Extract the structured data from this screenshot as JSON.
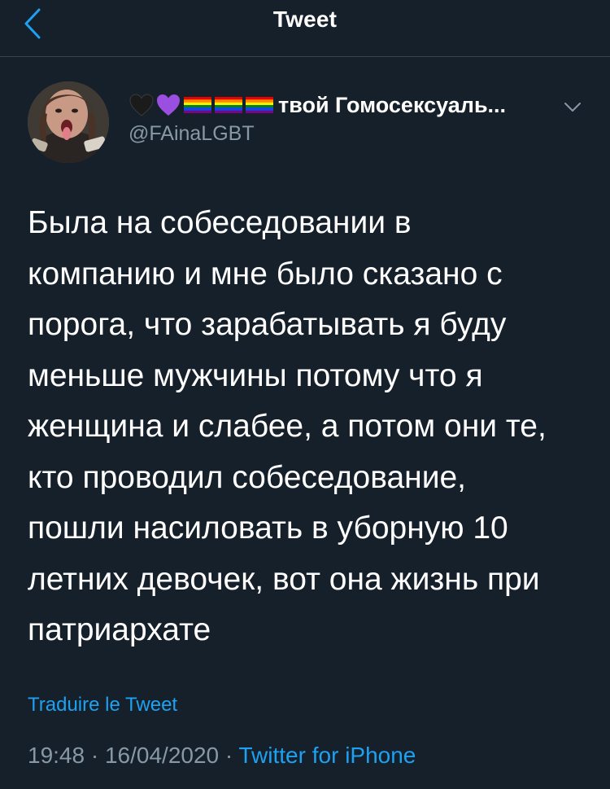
{
  "header": {
    "title": "Tweet",
    "back_icon": "chevron-left-icon"
  },
  "author": {
    "display_name": "твой Гомосексуаль...",
    "name_emojis": [
      "black-heart",
      "purple-heart",
      "rainbow-flag",
      "rainbow-flag",
      "rainbow-flag"
    ],
    "handle": "@FAinaLGBT"
  },
  "tweet": {
    "text": "Была на собеседовании в\nкомпанию и мне было сказано с\nпорога, что зарабатывать я буду\nменьше мужчины потому что я\nженщина и слабее, а потом они те,\nкто проводил собеседование,\nпошли насиловать в уборную 10\nлетних девочек, вот она жизнь при\nпатриархате",
    "translate_label": "Traduire le Tweet",
    "time": "19:48",
    "date": "16/04/2020",
    "separator": " · ",
    "source": "Twitter for iPhone"
  },
  "colors": {
    "background": "#15202b",
    "text": "#ffffff",
    "secondary": "#8899a6",
    "accent": "#1da1f2",
    "divider": "#38444d"
  }
}
